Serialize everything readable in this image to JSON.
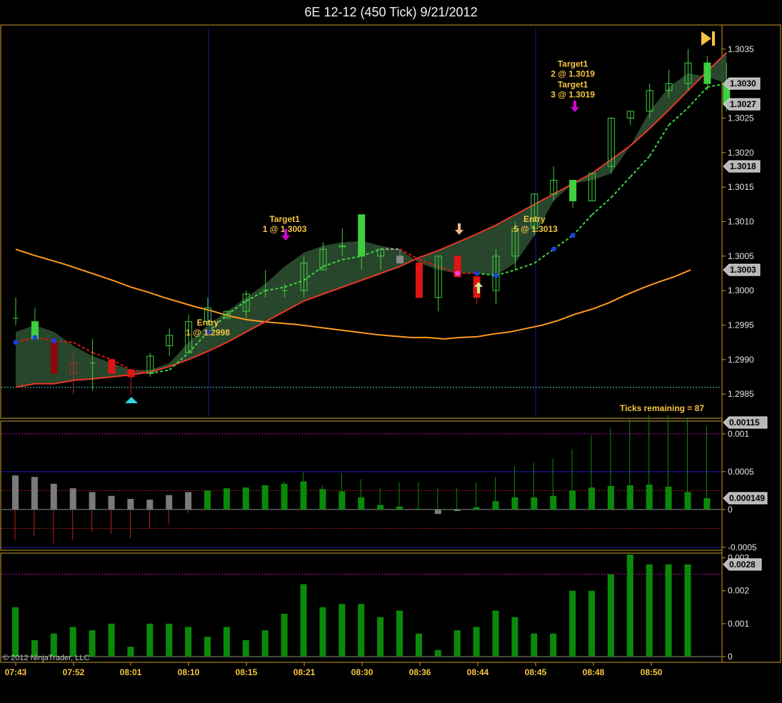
{
  "window": {
    "title": "6E 12-12 (450 Tick)  9/21/2012",
    "copyright": "© 2012 NinjaTrader, LLC"
  },
  "status": {
    "ticks_remaining": "Ticks remaining = 87"
  },
  "colors": {
    "background": "#000000",
    "border": "#c8a028",
    "up_candle": "#3fcf3f",
    "down_candle": "#e01515",
    "neutral_candle": "#808080",
    "band_fill": "#2a4a2e",
    "slow_ma": "#ff9a1f",
    "lower_band": "#e8382a",
    "signal_line": "#3fd63f",
    "hist_green": "#0a8a0a",
    "hist_gray": "#7a7a7a",
    "magenta": "#d400d4"
  },
  "icons": {
    "skip_to_end": "skip-to-end-icon",
    "buy_arrow": "up-arrow-icon",
    "sell_arrow": "down-arrow-icon",
    "triangle": "triangle-up-icon"
  },
  "chart_data": [
    {
      "type": "candlestick",
      "title": "6E 12-12 (450 Tick)  9/21/2012",
      "x_tick_labels": [
        "07:43",
        "07:52",
        "08:01",
        "08:10",
        "08:15",
        "08:21",
        "08:30",
        "08:36",
        "08:44",
        "08:45",
        "08:48",
        "08:50"
      ],
      "y_tick_labels": [
        "1.2985",
        "1.2990",
        "1.2995",
        "1.3000",
        "1.3005",
        "1.3010",
        "1.3015",
        "1.3020",
        "1.3025",
        "1.3030",
        "1.3035"
      ],
      "ylim": [
        1.29815,
        1.30385
      ],
      "price_badges": [
        "1.3030",
        "1.3027",
        "1.3018",
        "1.3003"
      ],
      "reference_line": 1.2986,
      "bars": [
        {
          "o": 1.2996,
          "h": 1.2999,
          "l": 1.2995,
          "c": 1.2996,
          "kind": "doji"
        },
        {
          "o": 1.2993,
          "h": 1.29975,
          "l": 1.2993,
          "c": 1.29955,
          "kind": "up_fill"
        },
        {
          "o": 1.29925,
          "h": 1.2993,
          "l": 1.2988,
          "c": 1.2988,
          "kind": "down_fill"
        },
        {
          "o": 1.2988,
          "h": 1.2991,
          "l": 1.2985,
          "c": 1.29895,
          "kind": "up_hollow"
        },
        {
          "o": 1.29895,
          "h": 1.2993,
          "l": 1.29855,
          "c": 1.29895,
          "kind": "doji"
        },
        {
          "o": 1.299,
          "h": 1.299,
          "l": 1.2988,
          "c": 1.2988,
          "kind": "down_fill"
        },
        {
          "o": 1.29885,
          "h": 1.29885,
          "l": 1.2985,
          "c": 1.29875,
          "kind": "down_fill"
        },
        {
          "o": 1.2988,
          "h": 1.2991,
          "l": 1.29875,
          "c": 1.29905,
          "kind": "up_hollow"
        },
        {
          "o": 1.2992,
          "h": 1.29945,
          "l": 1.29905,
          "c": 1.29935,
          "kind": "up_hollow"
        },
        {
          "o": 1.2991,
          "h": 1.29965,
          "l": 1.2991,
          "c": 1.29955,
          "kind": "up_hollow"
        },
        {
          "o": 1.29955,
          "h": 1.2999,
          "l": 1.2995,
          "c": 1.29975,
          "kind": "up_hollow"
        },
        {
          "o": 1.2996,
          "h": 1.2997,
          "l": 1.2996,
          "c": 1.2997,
          "kind": "up_hollow"
        },
        {
          "o": 1.2997,
          "h": 1.3,
          "l": 1.2996,
          "c": 1.29995,
          "kind": "up_hollow"
        },
        {
          "o": 1.29995,
          "h": 1.3003,
          "l": 1.2999,
          "c": 1.3,
          "kind": "doji"
        },
        {
          "o": 1.3,
          "h": 1.3001,
          "l": 1.2999,
          "c": 1.3,
          "kind": "doji"
        },
        {
          "o": 1.3,
          "h": 1.3005,
          "l": 1.2999,
          "c": 1.3004,
          "kind": "up_hollow"
        },
        {
          "o": 1.3003,
          "h": 1.3007,
          "l": 1.3003,
          "c": 1.3006,
          "kind": "up_hollow"
        },
        {
          "o": 1.30065,
          "h": 1.3009,
          "l": 1.3005,
          "c": 1.30065,
          "kind": "up_hollow"
        },
        {
          "o": 1.3005,
          "h": 1.3011,
          "l": 1.3003,
          "c": 1.3011,
          "kind": "up_fill"
        },
        {
          "o": 1.3005,
          "h": 1.3006,
          "l": 1.3003,
          "c": 1.3006,
          "kind": "up_hollow"
        },
        {
          "o": 1.3005,
          "h": 1.3006,
          "l": 1.3004,
          "c": 1.3004,
          "kind": "gray_fill"
        },
        {
          "o": 1.3004,
          "h": 1.3004,
          "l": 1.2999,
          "c": 1.2999,
          "kind": "down_fill"
        },
        {
          "o": 1.2999,
          "h": 1.3005,
          "l": 1.2997,
          "c": 1.3005,
          "kind": "up_hollow"
        },
        {
          "o": 1.3005,
          "h": 1.3005,
          "l": 1.3002,
          "c": 1.3002,
          "kind": "down_fill"
        },
        {
          "o": 1.3002,
          "h": 1.30025,
          "l": 1.2998,
          "c": 1.2999,
          "kind": "down_fill"
        },
        {
          "o": 1.3,
          "h": 1.3006,
          "l": 1.2998,
          "c": 1.3005,
          "kind": "up_hollow"
        },
        {
          "o": 1.3005,
          "h": 1.301,
          "l": 1.3003,
          "c": 1.3009,
          "kind": "up_hollow"
        },
        {
          "o": 1.3009,
          "h": 1.3014,
          "l": 1.3008,
          "c": 1.3014,
          "kind": "up_hollow"
        },
        {
          "o": 1.3014,
          "h": 1.3018,
          "l": 1.3013,
          "c": 1.3016,
          "kind": "up_hollow"
        },
        {
          "o": 1.3013,
          "h": 1.3016,
          "l": 1.3012,
          "c": 1.3016,
          "kind": "up_fill"
        },
        {
          "o": 1.3013,
          "h": 1.3017,
          "l": 1.3013,
          "c": 1.3017,
          "kind": "up_hollow"
        },
        {
          "o": 1.3018,
          "h": 1.3025,
          "l": 1.3017,
          "c": 1.3025,
          "kind": "up_hollow"
        },
        {
          "o": 1.3025,
          "h": 1.3026,
          "l": 1.3024,
          "c": 1.3026,
          "kind": "up_hollow"
        },
        {
          "o": 1.3026,
          "h": 1.303,
          "l": 1.3025,
          "c": 1.3029,
          "kind": "up_hollow"
        },
        {
          "o": 1.3029,
          "h": 1.3032,
          "l": 1.3028,
          "c": 1.303,
          "kind": "up_hollow"
        },
        {
          "o": 1.303,
          "h": 1.3035,
          "l": 1.3029,
          "c": 1.3033,
          "kind": "up_hollow"
        },
        {
          "o": 1.303,
          "h": 1.3034,
          "l": 1.3029,
          "c": 1.3033,
          "kind": "up_fill"
        },
        {
          "o": 1.303,
          "h": 1.3033,
          "l": 1.3026,
          "c": 1.3027,
          "kind": "down_green"
        }
      ],
      "fast_ma": [
        1.29925,
        1.29932,
        1.29927,
        1.29925,
        1.2991,
        1.299,
        1.29885,
        1.2988,
        1.29885,
        1.2991,
        1.2994,
        1.29965,
        1.29985,
        1.3,
        1.30005,
        1.30015,
        1.30035,
        1.30045,
        1.3005,
        1.3006,
        1.3006,
        1.30045,
        1.30035,
        1.30025,
        1.30025,
        1.30022,
        1.3003,
        1.3004,
        1.3006,
        1.3008,
        1.3011,
        1.30135,
        1.30165,
        1.30195,
        1.3024,
        1.30265,
        1.30295,
        1.303
      ],
      "upper_band": [
        1.2994,
        1.2995,
        1.2994,
        1.2992,
        1.29905,
        1.29895,
        1.29885,
        1.29885,
        1.29895,
        1.29925,
        1.2995,
        1.2997,
        1.2999,
        1.3001,
        1.30035,
        1.30055,
        1.30065,
        1.3007,
        1.30072,
        1.30065,
        1.3006,
        1.3004,
        1.3003,
        1.30025,
        1.30025,
        1.30022,
        1.3004,
        1.3008,
        1.3013,
        1.30155,
        1.3016,
        1.3017,
        1.3021,
        1.3026,
        1.30295,
        1.30315,
        1.3031,
        1.303
      ],
      "lower_band": [
        1.2986,
        1.29865,
        1.29865,
        1.2987,
        1.29872,
        1.29875,
        1.29878,
        1.29882,
        1.2989,
        1.299,
        1.29912,
        1.29925,
        1.2994,
        1.29955,
        1.2997,
        1.29985,
        1.29995,
        1.30005,
        1.30015,
        1.30025,
        1.30035,
        1.30048,
        1.30058,
        1.3007,
        1.30082,
        1.30095,
        1.3011,
        1.30125,
        1.3014,
        1.30155,
        1.3017,
        1.3019,
        1.3021,
        1.30235,
        1.30262,
        1.3029,
        1.30318,
        1.30345
      ],
      "slow_ma": [
        1.3006,
        1.30052,
        1.30045,
        1.30038,
        1.3003,
        1.30022,
        1.30014,
        1.30005,
        1.29998,
        1.2999,
        1.29983,
        1.29976,
        1.2997,
        1.29963,
        1.29958,
        1.29955,
        1.29953,
        1.29951,
        1.29948,
        1.29945,
        1.29942,
        1.29939,
        1.29936,
        1.29934,
        1.29932,
        1.29932,
        1.2993,
        1.29932,
        1.29933,
        1.29937,
        1.2994,
        1.29945,
        1.2995,
        1.29957,
        1.29966,
        1.29973,
        1.29982,
        1.29993,
        1.30003,
        1.30012,
        1.3002,
        1.3003
      ],
      "annotations": [
        {
          "bar": 14,
          "line1": "Target1",
          "line2": "1 @ 1.3003",
          "price": 1.30085
        },
        {
          "bar": 10,
          "line1": "Entry",
          "line2": "1 @ 1.2998",
          "price": 1.29935
        },
        {
          "bar": 27,
          "line1": "Entry",
          "line2": ".5 @ 1.3013",
          "price": 1.30085
        },
        {
          "bar": 29,
          "line1": "Target1",
          "line2": "2 @ 1.3019",
          "price": 1.3031
        },
        {
          "bar": 29,
          "line1": "Target1",
          "line2": "3 @ 1.3019",
          "price": 1.3028
        }
      ]
    },
    {
      "type": "histogram",
      "y_tick_labels": [
        "0.001",
        "0.0005",
        "0",
        "-0.0005"
      ],
      "ylim": [
        -0.00053,
        0.00115
      ],
      "badges": [
        "0.00115",
        "0.000149"
      ],
      "values": [
        0.00045,
        0.00043,
        0.00034,
        0.00028,
        0.00023,
        0.00018,
        0.00014,
        0.00013,
        0.00019,
        0.00023,
        0.00025,
        0.00028,
        0.00029,
        0.00032,
        0.00034,
        0.00037,
        0.00027,
        0.00024,
        0.00016,
        6e-05,
        4e-05,
        1e-05,
        -6e-05,
        -2e-05,
        3e-05,
        0.00011,
        0.00016,
        0.00016,
        0.00018,
        0.00025,
        0.00029,
        0.00031,
        0.00032,
        0.00033,
        0.0003,
        0.00023,
        0.000149
      ],
      "gray_until": 9,
      "dotted_levels": [
        0.001,
        0.00025,
        -0.00025
      ],
      "solid_levels": [
        0.0005,
        -0.0005
      ],
      "spikes": [
        [
          0.00045,
          -0.0004
        ],
        [
          0.00043,
          -0.00035
        ],
        [
          0.00034,
          -0.00045
        ],
        [
          0.00028,
          -0.0004
        ],
        [
          0.00023,
          -0.0003
        ],
        [
          0.00018,
          -0.00032
        ],
        [
          0.00014,
          -0.00038
        ],
        [
          0.00013,
          -0.00025
        ],
        [
          0.00019,
          -0.0002
        ],
        [
          0.00023,
          -5e-05
        ],
        [
          0.00025,
          0
        ],
        [
          0.00028,
          0
        ],
        [
          0.00029,
          0
        ],
        [
          0.00032,
          0
        ],
        [
          0.00037,
          0
        ],
        [
          0.00049,
          0
        ],
        [
          0.00032,
          0
        ],
        [
          0.00048,
          0
        ],
        [
          0.0004,
          0
        ],
        [
          0.00029,
          0
        ],
        [
          0.00036,
          0
        ],
        [
          0.00036,
          0
        ],
        [
          0.00028,
          0
        ],
        [
          0.00028,
          0
        ],
        [
          0.00036,
          0
        ],
        [
          0.00043,
          0
        ],
        [
          0.00057,
          0
        ],
        [
          0.00062,
          0
        ],
        [
          0.00067,
          0
        ],
        [
          0.0008,
          0
        ],
        [
          0.00098,
          0
        ],
        [
          0.00108,
          0
        ],
        [
          0.0012,
          0
        ],
        [
          0.00125,
          0
        ],
        [
          0.00125,
          0
        ],
        [
          0.0012,
          0
        ],
        [
          0.0011,
          0
        ]
      ]
    },
    {
      "type": "bar",
      "y_tick_labels": [
        "0.003",
        "0.002",
        "0.001",
        "0"
      ],
      "ylim": [
        0,
        0.0031
      ],
      "badges": [
        "0.0028"
      ],
      "dotted_level": 0.0025,
      "values": [
        0.0015,
        0.0005,
        0.0007,
        0.0009,
        0.0008,
        0.001,
        0.0003,
        0.001,
        0.001,
        0.0009,
        0.0006,
        0.0009,
        0.0005,
        0.0008,
        0.0013,
        0.0022,
        0.0015,
        0.0016,
        0.0016,
        0.0012,
        0.0014,
        0.0007,
        0.0002,
        0.0008,
        0.0009,
        0.0014,
        0.0012,
        0.0007,
        0.0007,
        0.002,
        0.002,
        0.0025,
        0.0031,
        0.0028,
        0.0028,
        0.0028
      ]
    }
  ]
}
